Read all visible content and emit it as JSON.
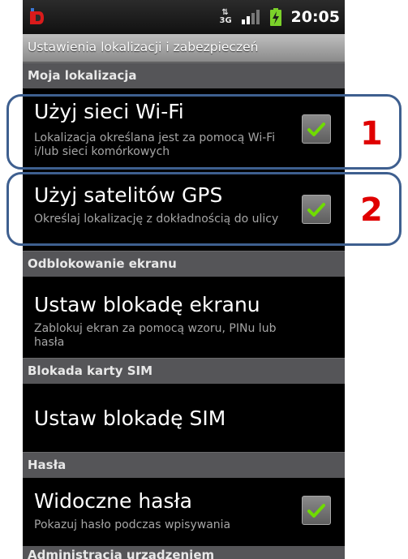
{
  "status_bar": {
    "network_type_top": "⇅",
    "network_type_bottom": "3G",
    "time": "20:05",
    "icons": [
      "notification-icon",
      "network-3g-icon",
      "signal-icon",
      "battery-charging-icon"
    ]
  },
  "title": "Ustawienia lokalizacji i zabezpieczeń",
  "sections": {
    "my_location": "Moja lokalizacja",
    "screen_unlock": "Odblokowanie ekranu",
    "sim_lock": "Blokada karty SIM",
    "passwords": "Hasła",
    "device_admin": "Administracja urządzeniem"
  },
  "items": {
    "wifi": {
      "title": "Użyj sieci Wi-Fi",
      "summary": "Lokalizacja określana jest za pomocą Wi-Fi i/lub sieci komórkowych",
      "checked": true
    },
    "gps": {
      "title": "Użyj satelitów GPS",
      "summary": "Określaj lokalizację z dokładnością do ulicy",
      "checked": true
    },
    "screen_lock": {
      "title": "Ustaw blokadę ekranu",
      "summary": "Zablokuj ekran za pomocą wzoru, PINu lub hasła"
    },
    "sim_lock": {
      "title": "Ustaw blokadę SIM"
    },
    "visible_passwords": {
      "title": "Widoczne hasła",
      "summary": "Pokazuj hasło podczas wpisywania",
      "checked": true
    }
  },
  "annotations": {
    "label_1": "1",
    "label_2": "2"
  },
  "colors": {
    "annotation_border": "#3e5f8f",
    "annotation_number": "#e00000",
    "checkmark": "#6fdc00"
  }
}
